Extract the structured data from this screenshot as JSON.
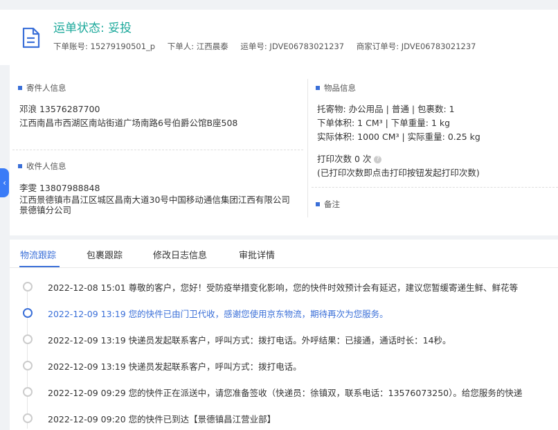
{
  "header": {
    "status": "运单状态: 妥投",
    "order_account": "下单账号: 15279190501_p",
    "orderer": "下单人: 江西晨泰",
    "waybill_no": "运单号: JDVE06783021237",
    "merchant_order_no": "商家订单号: JDVE06783021237",
    "icon": "document-icon"
  },
  "sender": {
    "title": "寄件人信息",
    "name_phone": "邓浪    13576287700",
    "address": "江西南昌市西湖区南站街道广场南路6号伯爵公馆B座508"
  },
  "receiver": {
    "title": "收件人信息",
    "name_phone": "李雯    13807988848",
    "address": "江西景德镇市昌江区城区昌南大道30号中国移动通信集团江西有限公司景德镇分公司"
  },
  "goods": {
    "title": "物品信息",
    "line1": "托寄物:  办公用品 | 普通  |  包裹数:  1",
    "line2": "下单体积:    1 CM³  |  下单重量:    1 kg",
    "line3": "实际体积:    1000 CM³  |  实际重量:    0.25 kg",
    "print_count": "打印次数    0 次",
    "print_note": "(已打印次数即点击打印按钮发起打印次数)"
  },
  "remark": {
    "title": "备注"
  },
  "collapse_tab": "‹",
  "tabs": [
    "物流跟踪",
    "包裹跟踪",
    "修改日志信息",
    "审批详情"
  ],
  "timeline": [
    {
      "text": "2022-12-08 15:01 尊敬的客户，您好！受防疫举措变化影响，您的快件时效预计会有延迟，建议您暂缓寄递生鲜、鲜花等",
      "active": false
    },
    {
      "text": "2022-12-09 13:19 您的快件已由门卫代收，感谢您使用京东物流，期待再次为您服务。",
      "active": true
    },
    {
      "text": "2022-12-09 13:19 快递员发起联系客户，呼叫方式：拨打电话。外呼结果：已接通，通话时长：14秒。",
      "active": false
    },
    {
      "text": "2022-12-09 13:19 快递员发起联系客户，呼叫方式：拨打电话。",
      "active": false
    },
    {
      "text": "2022-12-09 09:29 您的快件正在派送中，请您准备签收（快递员：徐镇双，联系电话：13576073250）。给您服务的快递",
      "active": false
    },
    {
      "text": "2022-12-09 09:20 您的快件已到达【景德镇昌江营业部】",
      "active": false
    }
  ],
  "colors": {
    "accent": "#3a6fd8",
    "status": "#1aa89a"
  }
}
